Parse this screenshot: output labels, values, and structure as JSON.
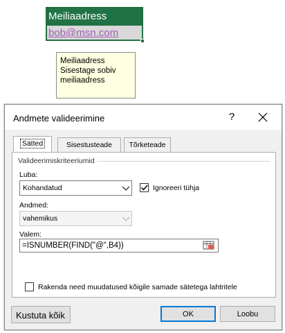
{
  "sheet": {
    "header": "Meiliaadress",
    "cell_value": "bob@msn.com"
  },
  "tooltip": {
    "title": "Meiliaadress",
    "line1": "Sisestage sobiv",
    "line2": "meiliaadress"
  },
  "dialog": {
    "title": "Andmete valideerimine",
    "help": "?",
    "close_icon": "close-icon",
    "tabs": [
      {
        "label": "Sätted",
        "active": true
      },
      {
        "label": "Sisestusteade",
        "active": false
      },
      {
        "label": "Tõrketeade",
        "active": false
      }
    ],
    "criteria_group": "Valideerimiskriteeriumid",
    "allow_label": "Luba:",
    "allow_value": "Kohandatud",
    "ignore_blank_label": "Ignoreeri tühja",
    "ignore_blank_checked": true,
    "data_label": "Andmed:",
    "data_value": "vahemikus",
    "formula_label": "Valem:",
    "formula_value": "=ISNUMBER(FIND(\"@\",B4))",
    "apply_all_label": "Rakenda need muudatused kõigile samade sätetega lahtritele",
    "apply_all_checked": false,
    "clear_all_label": "Kustuta kõik",
    "ok_label": "OK",
    "cancel_label": "Loobu"
  },
  "colors": {
    "excel_green": "#217346",
    "tooltip_bg": "#ffffe1",
    "focus_blue": "#0078d7"
  }
}
